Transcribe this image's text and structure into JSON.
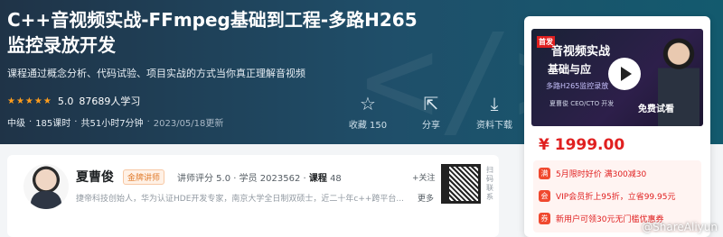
{
  "course": {
    "title": "C++音视频实战-FFmpeg基础到工程-多路H265监控录放开发",
    "subtitle": "课程通过概念分析、代码试验、项目实战的方式当你真正理解音视频",
    "stars": "★★★★★",
    "rating": "5.0",
    "learners": "87689人学习",
    "level": "中级",
    "sep": "·",
    "lessons": "185课时",
    "duration": "共51小时7分钟",
    "updated": "2023/05/18更新"
  },
  "actions": [
    {
      "icon": "star-icon",
      "glyph": "☆",
      "label": "收藏 150"
    },
    {
      "icon": "share-icon",
      "glyph": "⇱",
      "label": "分享"
    },
    {
      "icon": "download-icon",
      "glyph": "⤓",
      "label": "资料下载"
    }
  ],
  "teacher": {
    "name": "夏曹俊",
    "badge": "金牌讲师",
    "stats_prefix": "讲师评分 5.0 · 学员 2023562 · ",
    "course_label": "课程",
    "course_count": "48",
    "follow": "+关注",
    "desc": "捷帝科技创始人，华为认证HDE开发专家，南京大学全日制双硕士，近二十年c++跨平台...",
    "more": "更多",
    "qr_side": "扫码联系"
  },
  "sidebar": {
    "thumb_tag": "首发",
    "thumb_line1": "音视频实战",
    "thumb_line2": "基础与应",
    "thumb_line3": "多路H265监控录放",
    "thumb_line4": "夏曹俊 CEO/CTO   开发",
    "free_preview": "免费试看",
    "price": "¥ 1999.00",
    "promos": [
      {
        "icon": "满",
        "text": "5月限时好价 满300减30"
      },
      {
        "icon": "会",
        "text": "VIP会员折上95折，立省99.95元"
      },
      {
        "icon": "券",
        "text": "新用户可领30元无门槛优惠券"
      }
    ]
  },
  "watermark": "@ShareAliyun"
}
